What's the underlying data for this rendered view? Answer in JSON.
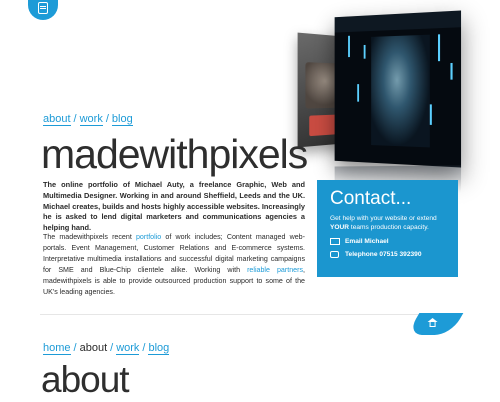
{
  "nav_top": {
    "items": [
      "about",
      "work",
      "blog"
    ],
    "separator": "/"
  },
  "site_title": "madewithpixels",
  "intro": {
    "bold": "The online portfolio of Michael Auty, a freelance Graphic, Web and Multimedia Designer. Working in and around Sheffield, Leeds and the UK. Michael creates, builds and hosts highly accessible websites. Increasingly he is asked to lend digital marketers and communications agencies a helping hand.",
    "body_1": "The madewithpixels recent ",
    "link_portfolio": "portfolio",
    "body_2": " of work includes; Content managed web-portals. Event Management, Customer Relations and E-commerce systems. Interpretative multimedia installations and successful digital marketing campaigns for SME and Blue-Chip clientele alike. Working with ",
    "link_partners": "reliable partners",
    "body_3": ", madewithpixels is able to provide outsourced production support to some of the UK's leading agencies."
  },
  "contact": {
    "title": "Contact...",
    "text_1": "Get help with your website or extend ",
    "text_bold": "YOUR",
    "text_2": " teams production capacity.",
    "email_label": "Email Michael",
    "phone_label": "Telephone 07515 392390"
  },
  "nav_bottom": {
    "items": [
      "home",
      "about",
      "work",
      "blog"
    ],
    "separator": "/"
  },
  "section_title": "about",
  "colors": {
    "accent": "#1d9bd7",
    "text": "#2b2b2b",
    "contact_bg": "#1b96cf"
  },
  "icons": {
    "corner_tab": "document-icon",
    "email": "envelope-icon",
    "phone": "speech-bubble-icon",
    "home": "home-icon"
  }
}
